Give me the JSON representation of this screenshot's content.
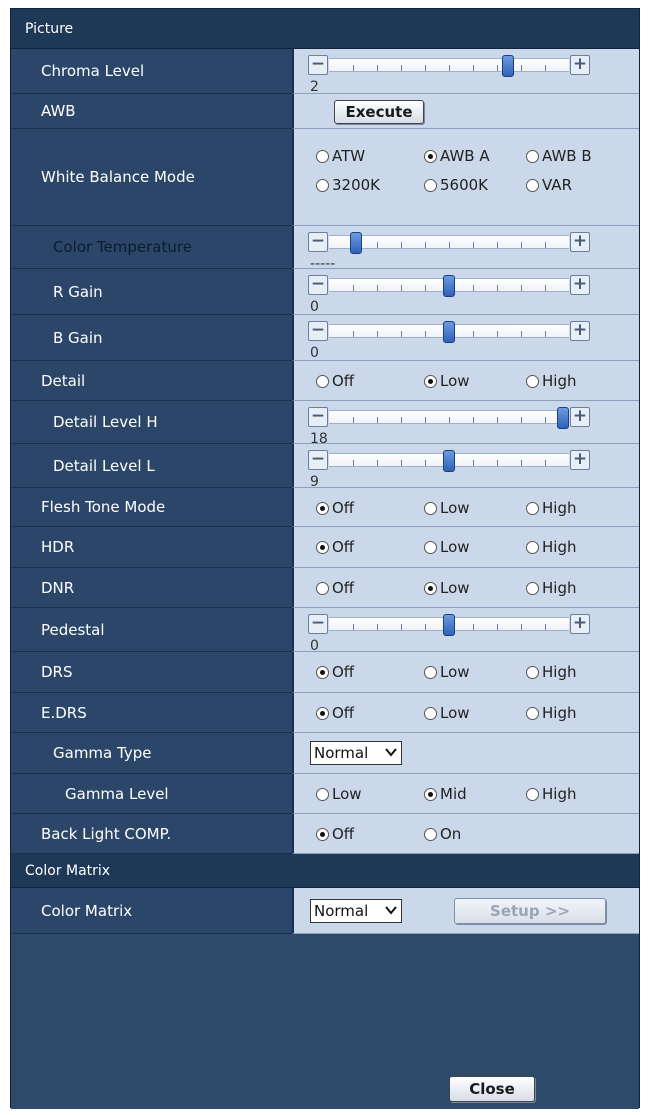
{
  "sections": {
    "picture": "Picture",
    "color_matrix": "Color Matrix"
  },
  "rows": {
    "chroma_level": {
      "label": "Chroma Level",
      "value": "2",
      "level": 0.76
    },
    "awb": {
      "label": "AWB",
      "button": "Execute"
    },
    "white_balance_mode": {
      "label": "White Balance Mode",
      "options": [
        "ATW",
        "AWB A",
        "AWB B",
        "3200K",
        "5600K",
        "VAR"
      ],
      "selected": "AWB A"
    },
    "color_temperature": {
      "label": "Color Temperature",
      "value": "-----",
      "level": 0.09
    },
    "r_gain": {
      "label": "R Gain",
      "value": "0",
      "level": 0.5
    },
    "b_gain": {
      "label": "B Gain",
      "value": "0",
      "level": 0.5
    },
    "detail": {
      "label": "Detail",
      "options": [
        "Off",
        "Low",
        "High"
      ],
      "selected": "Low"
    },
    "detail_level_h": {
      "label": "Detail Level H",
      "value": "18",
      "level": 1.0
    },
    "detail_level_l": {
      "label": "Detail Level L",
      "value": "9",
      "level": 0.5
    },
    "flesh_tone_mode": {
      "label": "Flesh Tone Mode",
      "options": [
        "Off",
        "Low",
        "High"
      ],
      "selected": "Off"
    },
    "hdr": {
      "label": "HDR",
      "options": [
        "Off",
        "Low",
        "High"
      ],
      "selected": "Off"
    },
    "dnr": {
      "label": "DNR",
      "options": [
        "Off",
        "Low",
        "High"
      ],
      "selected": "Low"
    },
    "pedestal": {
      "label": "Pedestal",
      "value": "0",
      "level": 0.5
    },
    "drs": {
      "label": "DRS",
      "options": [
        "Off",
        "Low",
        "High"
      ],
      "selected": "Off"
    },
    "edrs": {
      "label": "E.DRS",
      "options": [
        "Off",
        "Low",
        "High"
      ],
      "selected": "Off"
    },
    "gamma_type": {
      "label": "Gamma Type",
      "selected": "Normal"
    },
    "gamma_level": {
      "label": "Gamma Level",
      "options": [
        "Low",
        "Mid",
        "High"
      ],
      "selected": "Mid"
    },
    "back_light_comp": {
      "label": "Back Light COMP.",
      "options": [
        "Off",
        "On"
      ],
      "selected": "Off"
    },
    "color_matrix": {
      "label": "Color Matrix",
      "selected": "Normal",
      "button": "Setup >>"
    }
  },
  "footer": {
    "close_label": "Close"
  },
  "icons": {
    "minus": "minus-icon",
    "plus": "plus-icon",
    "chevron": "chevron-down-icon"
  },
  "colors": {
    "label_bg": "#2b4668",
    "value_bg": "#cad8ea",
    "header_bg": "#1e3858",
    "knob": "#2f62b8"
  }
}
